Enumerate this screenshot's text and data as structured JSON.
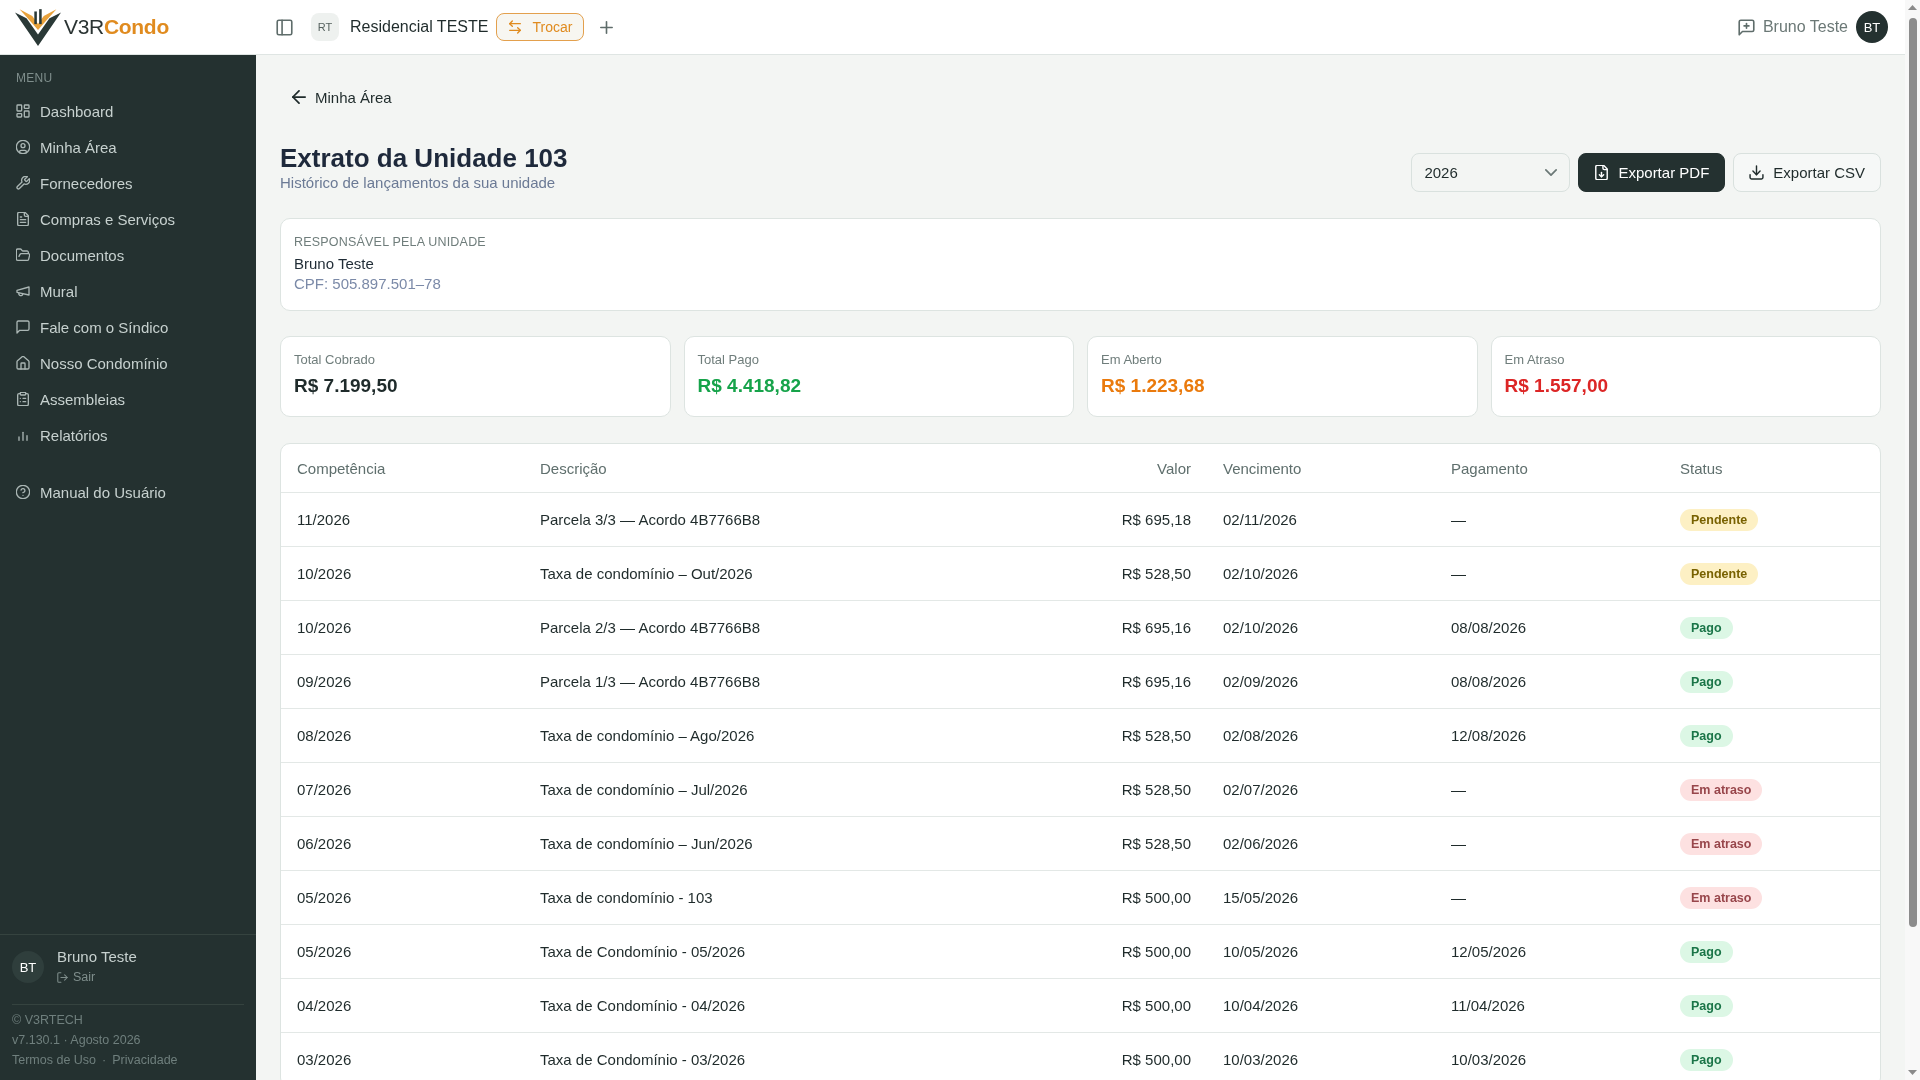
{
  "header": {
    "logo_text": "V3R**Condo**",
    "condominium": {
      "initials": "RT",
      "name": "Residencial TESTE"
    },
    "switch_button": "Trocar",
    "user": {
      "name": "Bruno Teste",
      "initials": "BT"
    }
  },
  "sidebar": {
    "section_label": "MENU",
    "items": [
      {
        "label": "Dashboard",
        "selected": false
      },
      {
        "label": "Minha Área",
        "selected": false
      },
      {
        "label": "Fornecedores",
        "selected": false
      },
      {
        "label": "Compras e Serviços",
        "selected": false
      },
      {
        "label": "Documentos",
        "selected": false
      },
      {
        "label": "Mural",
        "selected": false
      },
      {
        "label": "Fale com o Síndico",
        "selected": false
      },
      {
        "label": "Nosso Condomínio",
        "selected": false
      },
      {
        "label": "Assembleias",
        "selected": false
      },
      {
        "label": "Relatórios",
        "selected": false
      }
    ],
    "help_item": {
      "label": "Manual do Usuário",
      "selected": false
    },
    "user": {
      "initials": "BT",
      "name": "Bruno Teste",
      "logout": "Sair"
    },
    "footer": {
      "copyright": "© V3RTECH",
      "version": "v7.130.1 · Agosto 2026",
      "links": [
        "Termos de Uso",
        "Privacidade"
      ],
      "separator": "·"
    }
  },
  "page": {
    "back_link": "Minha Área",
    "title": "Extrato da Unidade 103",
    "subtitle": "Histórico de lançamentos da sua unidade",
    "year_select": {
      "value": "2026"
    },
    "actions": [
      {
        "label": "Exportar PDF",
        "kind": "primary"
      },
      {
        "label": "Exportar CSV",
        "kind": "secondary"
      }
    ],
    "responsible": {
      "heading": "RESPONSÁVEL PELA UNIDADE",
      "name": "Bruno Teste",
      "document": "CPF: 505.897.501–78"
    },
    "stats": [
      {
        "label": "Total Cobrado",
        "value": "R$ 7.199,50",
        "color": "#1f2b2b"
      },
      {
        "label": "Total Pago",
        "value": "R$ 4.418,82",
        "color": "#16a34a"
      },
      {
        "label": "Em Aberto",
        "value": "R$ 1.223,68",
        "color": "#ea7a0c"
      },
      {
        "label": "Em Atraso",
        "value": "R$ 1.557,00",
        "color": "#dc2626"
      }
    ],
    "table": {
      "columns": [
        "Competência",
        "Descrição",
        "Valor",
        "Vencimento",
        "Pagamento",
        "Status"
      ],
      "rows": [
        {
          "period": "11/2026",
          "description": "Parcela 3/3 — Acordo 4B7766B8",
          "amount": "R$ 695,18",
          "due_date": "02/11/2026",
          "paid_date": "—",
          "status": {
            "label": "Pendente",
            "color": "#fdf0c4"
          }
        },
        {
          "period": "10/2026",
          "description": "Taxa de condomínio – Out/2026",
          "amount": "R$ 528,50",
          "due_date": "02/10/2026",
          "paid_date": "—",
          "status": {
            "label": "Pendente",
            "color": "#fdf0c4"
          }
        },
        {
          "period": "10/2026",
          "description": "Parcela 2/3 — Acordo 4B7766B8",
          "amount": "R$ 695,16",
          "due_date": "02/10/2026",
          "paid_date": "08/08/2026",
          "status": {
            "label": "Pago",
            "color": "#dcf7e5"
          }
        },
        {
          "period": "09/2026",
          "description": "Parcela 1/3 — Acordo 4B7766B8",
          "amount": "R$ 695,16",
          "due_date": "02/09/2026",
          "paid_date": "08/08/2026",
          "status": {
            "label": "Pago",
            "color": "#dcf7e5"
          }
        },
        {
          "period": "08/2026",
          "description": "Taxa de condomínio – Ago/2026",
          "amount": "R$ 528,50",
          "due_date": "02/08/2026",
          "paid_date": "12/08/2026",
          "status": {
            "label": "Pago",
            "color": "#dcf7e5"
          }
        },
        {
          "period": "07/2026",
          "description": "Taxa de condomínio – Jul/2026",
          "amount": "R$ 528,50",
          "due_date": "02/07/2026",
          "paid_date": "—",
          "status": {
            "label": "Em atraso",
            "color": "#fde1e1"
          }
        },
        {
          "period": "06/2026",
          "description": "Taxa de condomínio – Jun/2026",
          "amount": "R$ 528,50",
          "due_date": "02/06/2026",
          "paid_date": "—",
          "status": {
            "label": "Em atraso",
            "color": "#fde1e1"
          }
        },
        {
          "period": "05/2026",
          "description": "Taxa de condomínio - 103",
          "amount": "R$ 500,00",
          "due_date": "15/05/2026",
          "paid_date": "—",
          "status": {
            "label": "Em atraso",
            "color": "#fde1e1"
          }
        },
        {
          "period": "05/2026",
          "description": "Taxa de Condomínio - 05/2026",
          "amount": "R$ 500,00",
          "due_date": "10/05/2026",
          "paid_date": "12/05/2026",
          "status": {
            "label": "Pago",
            "color": "#dcf7e5"
          }
        },
        {
          "period": "04/2026",
          "description": "Taxa de Condomínio - 04/2026",
          "amount": "R$ 500,00",
          "due_date": "10/04/2026",
          "paid_date": "11/04/2026",
          "status": {
            "label": "Pago",
            "color": "#dcf7e5"
          }
        },
        {
          "period": "03/2026",
          "description": "Taxa de Condomínio - 03/2026",
          "amount": "R$ 500,00",
          "due_date": "10/03/2026",
          "paid_date": "10/03/2026",
          "status": {
            "label": "Pago",
            "color": "#dcf7e5"
          }
        }
      ]
    }
  }
}
